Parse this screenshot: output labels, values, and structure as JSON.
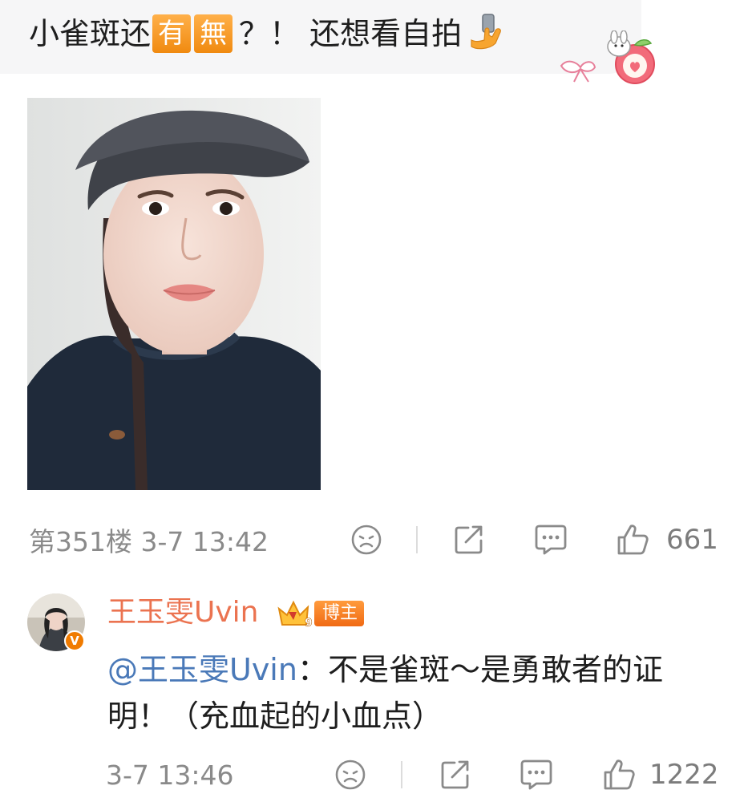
{
  "post": {
    "text_prefix": "小雀斑还",
    "tag1": "有",
    "tag2": "無",
    "text_suffix": "？！ 还想看自拍",
    "emoji": "selfie-phone-emoji",
    "sticker": "bunny-apple-bow-sticker",
    "photo": "selfie-photo-girl-in-cap",
    "floor_time": "第351楼 3-7 13:42",
    "like_count": "661"
  },
  "reply": {
    "username": "王玉雯Uvin",
    "level": "9",
    "role_badge": "博主",
    "mention": "@王玉雯Uvin",
    "text": "：不是雀斑～是勇敢者的证明！（充血起的小血点）",
    "time": "3-7 13:46",
    "like_count": "1222"
  },
  "colors": {
    "username": "#eb7350",
    "mention": "#4a79b8",
    "meta": "#8a8a8a",
    "badge": "#f07b00"
  },
  "icons": [
    "dislike-face-icon",
    "share-icon",
    "comment-icon",
    "like-thumb-icon"
  ]
}
